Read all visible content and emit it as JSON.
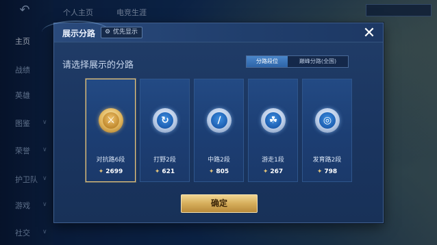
{
  "background": {
    "top_tabs": [
      "个人主页",
      "电竞生涯"
    ],
    "sidebar_items": [
      "主页",
      "战绩",
      "英雄",
      "图鉴",
      "荣誉",
      "护卫队",
      "游戏",
      "社交"
    ]
  },
  "modal": {
    "title": "展示分路",
    "priority_label": "优先显示",
    "close_icon": "close-icon",
    "subtitle": "请选择展示的分路",
    "toggle": {
      "options": [
        "分路段位",
        "巅峰分路(全国)"
      ],
      "selected_index": 0
    },
    "cards": [
      {
        "label": "对抗路6段",
        "score": "2699",
        "selected": true,
        "tier_color": "gold"
      },
      {
        "label": "打野2段",
        "score": "621",
        "selected": false,
        "tier_color": "blue"
      },
      {
        "label": "中路2段",
        "score": "805",
        "selected": false,
        "tier_color": "blue"
      },
      {
        "label": "游走1段",
        "score": "267",
        "selected": false,
        "tier_color": "blue"
      },
      {
        "label": "发育路2段",
        "score": "798",
        "selected": false,
        "tier_color": "blue"
      }
    ],
    "confirm_label": "确定"
  },
  "colors": {
    "accent_gold": "#e8c57a",
    "button_gold": "#d6ae5b",
    "toggle_active": "#2d64a8"
  }
}
